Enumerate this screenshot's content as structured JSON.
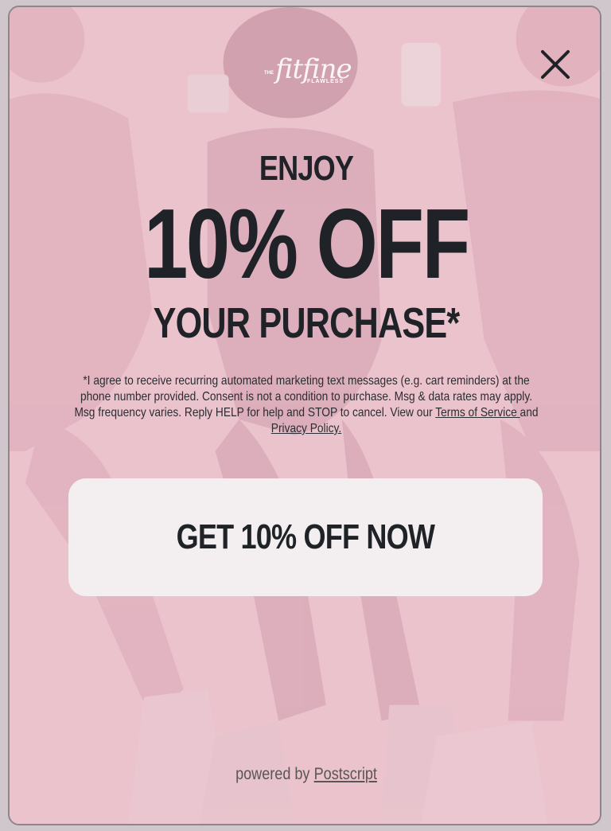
{
  "modal": {
    "logo": {
      "prefix": "THE",
      "script": "fitfine",
      "sub": "FLAWLESS"
    },
    "close_icon": "close-icon",
    "headline": {
      "line1": "ENJOY",
      "line2": "10% OFF",
      "line3": "YOUR PURCHASE*"
    },
    "disclaimer": {
      "text": "*I agree to receive recurring automated marketing text messages (e.g. cart reminders) at the phone number provided. Consent is not a condition to purchase. Msg & data rates may apply. Msg frequency varies. Reply HELP for help and STOP to cancel. View our ",
      "terms_link": "Terms of Service ",
      "and": "and ",
      "privacy_link": "Privacy Policy."
    },
    "cta_label": "GET 10% OFF NOW",
    "footer": {
      "powered_by": "powered by",
      "brand_link": "Postscript"
    },
    "colors": {
      "background_tint": "#e9c2cc",
      "text": "#1f2327",
      "button": "#f3eff0"
    }
  }
}
